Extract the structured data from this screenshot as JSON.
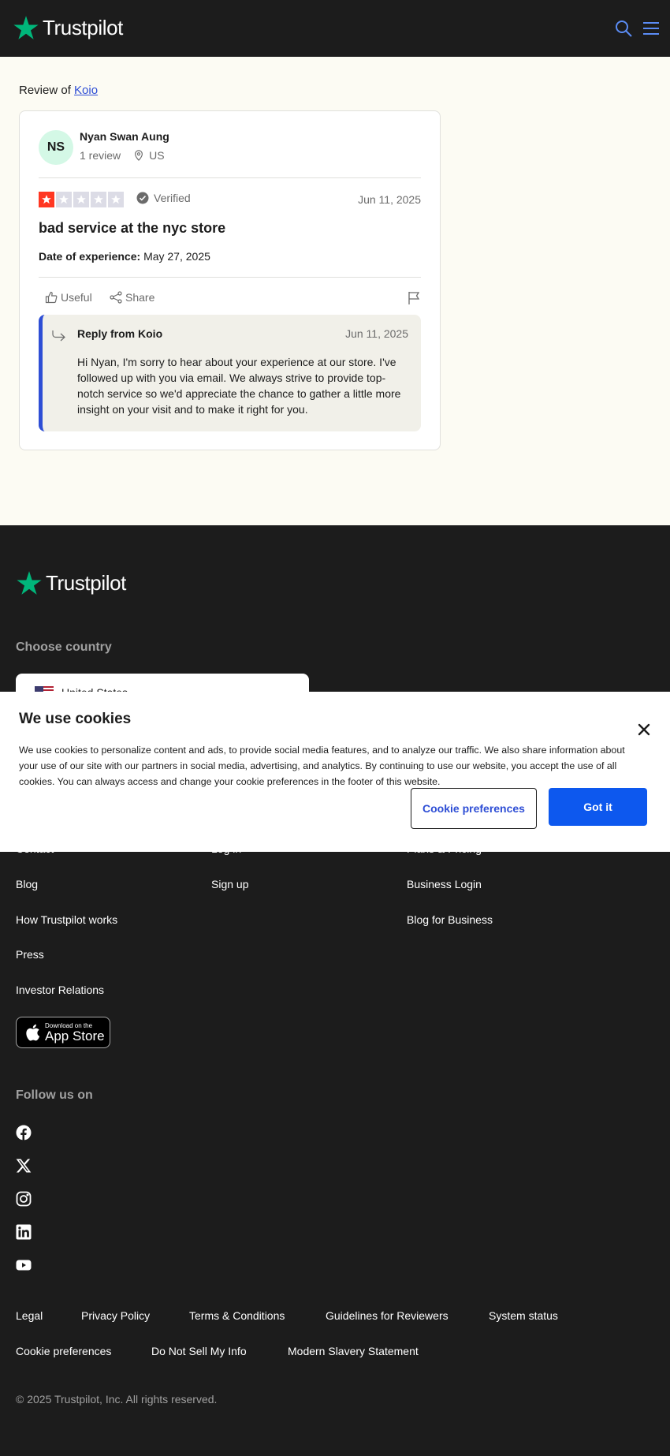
{
  "header": {
    "logo_text": "Trustpilot",
    "search_icon": "search-icon",
    "menu_icon": "hamburger-menu-icon"
  },
  "review": {
    "review_of_prefix": "Review of",
    "company": "Koio",
    "author": {
      "initials": "NS",
      "name": "Nyan Swan Aung",
      "review_count": "1 review",
      "country": "US"
    },
    "rating": 1,
    "rating_max": 5,
    "verified_label": "Verified",
    "date": "Jun 11, 2025",
    "title": "bad service at the nyc store",
    "experience_label": "Date of experience:",
    "experience_date": "May 27, 2025",
    "useful_label": "Useful",
    "share_label": "Share",
    "reply": {
      "from": "Reply from Koio",
      "date": "Jun 11, 2025",
      "text": "Hi Nyan, I'm sorry to hear about your experience at our store. I've followed up with you via email. We always strive to provide top-notch service so we'd appreciate the chance to gather a little more insight on your visit and to make it right for you."
    }
  },
  "footer": {
    "logo_text": "Trustpilot",
    "choose_country": "Choose country",
    "selected_country": "United States",
    "col1": [
      "Contact",
      "Blog",
      "How Trustpilot works",
      "Press",
      "Investor Relations"
    ],
    "col2": [
      "Log in",
      "Sign up"
    ],
    "col3": [
      "Plans & Pricing",
      "Business Login",
      "Blog for Business"
    ],
    "app_store": {
      "small": "Download on the",
      "big": "App Store"
    },
    "follow_us": "Follow us on",
    "social_icons": [
      "facebook-icon",
      "x-icon",
      "instagram-icon",
      "linkedin-icon",
      "youtube-icon"
    ],
    "legal_links": [
      "Legal",
      "Privacy Policy",
      "Terms & Conditions",
      "Guidelines for Reviewers",
      "System status",
      "Cookie preferences",
      "Do Not Sell My Info",
      "Modern Slavery Statement"
    ],
    "copyright": "© 2025 Trustpilot, Inc. All rights reserved."
  },
  "cookie": {
    "title": "We use cookies",
    "text": "We use cookies to personalize content and ads, to provide social media features, and to analyze our traffic. We also share information about your use of our site with our partners in social media, advertising, and analytics. By continuing to use our website, you accept the use of all cookies. You can always access and change your cookie preferences in the footer of this website.",
    "prefs_button": "Cookie preferences",
    "accept_button": "Got it"
  },
  "colors": {
    "brand_green": "#00b67a",
    "star_red": "#ff3722",
    "link_blue": "#2e4ed5",
    "button_blue": "#0d58ee",
    "dark_bg": "#1c1c1c",
    "page_bg": "#fcfbf3"
  }
}
